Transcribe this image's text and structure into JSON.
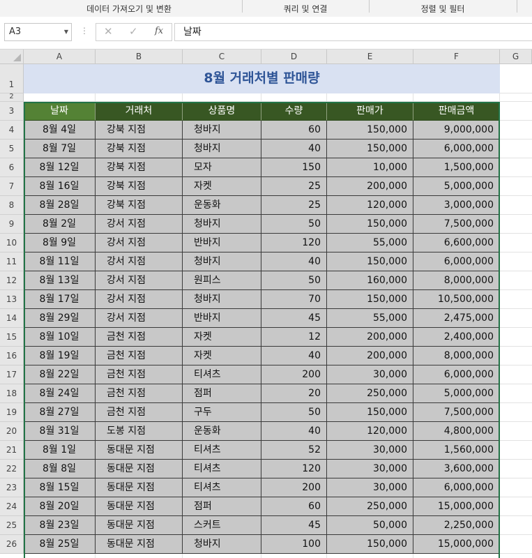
{
  "ribbon": {
    "groups": [
      "데이터 가져오기 및 변환",
      "쿼리 및 연결",
      "정렬 및 필터"
    ]
  },
  "formula_bar": {
    "name_box": "A3",
    "cancel_icon": "✕",
    "enter_icon": "✓",
    "fx_label": "fx",
    "formula": "날짜"
  },
  "columns": [
    "A",
    "B",
    "C",
    "D",
    "E",
    "F",
    "G"
  ],
  "rows": [
    "1",
    "2",
    "3",
    "4",
    "5",
    "6",
    "7",
    "8",
    "9",
    "10",
    "11",
    "12",
    "13",
    "14",
    "15",
    "16",
    "17",
    "18",
    "19",
    "20",
    "21",
    "22",
    "23",
    "24",
    "25",
    "26"
  ],
  "sheet": {
    "title": "8월 거래처별 판매량",
    "headers": [
      "날짜",
      "거래처",
      "상품명",
      "수량",
      "판매가",
      "판매금액"
    ],
    "data": [
      [
        "8월 4일",
        "강북 지점",
        "청바지",
        "60",
        "150,000",
        "9,000,000"
      ],
      [
        "8월 7일",
        "강북 지점",
        "청바지",
        "40",
        "150,000",
        "6,000,000"
      ],
      [
        "8월 12일",
        "강북 지점",
        "모자",
        "150",
        "10,000",
        "1,500,000"
      ],
      [
        "8월 16일",
        "강북 지점",
        "자켓",
        "25",
        "200,000",
        "5,000,000"
      ],
      [
        "8월 28일",
        "강북 지점",
        "운동화",
        "25",
        "120,000",
        "3,000,000"
      ],
      [
        "8월 2일",
        "강서 지점",
        "청바지",
        "50",
        "150,000",
        "7,500,000"
      ],
      [
        "8월 9일",
        "강서 지점",
        "반바지",
        "120",
        "55,000",
        "6,600,000"
      ],
      [
        "8월 11일",
        "강서 지점",
        "청바지",
        "40",
        "150,000",
        "6,000,000"
      ],
      [
        "8월 13일",
        "강서 지점",
        "원피스",
        "50",
        "160,000",
        "8,000,000"
      ],
      [
        "8월 17일",
        "강서 지점",
        "청바지",
        "70",
        "150,000",
        "10,500,000"
      ],
      [
        "8월 29일",
        "강서 지점",
        "반바지",
        "45",
        "55,000",
        "2,475,000"
      ],
      [
        "8월 10일",
        "금천 지점",
        "자켓",
        "12",
        "200,000",
        "2,400,000"
      ],
      [
        "8월 19일",
        "금천 지점",
        "자켓",
        "40",
        "200,000",
        "8,000,000"
      ],
      [
        "8월 22일",
        "금천 지점",
        "티셔츠",
        "200",
        "30,000",
        "6,000,000"
      ],
      [
        "8월 24일",
        "금천 지점",
        "점퍼",
        "20",
        "250,000",
        "5,000,000"
      ],
      [
        "8월 27일",
        "금천 지점",
        "구두",
        "50",
        "150,000",
        "7,500,000"
      ],
      [
        "8월 31일",
        "도봉 지점",
        "운동화",
        "40",
        "120,000",
        "4,800,000"
      ],
      [
        "8월 1일",
        "동대문 지점",
        "티셔츠",
        "52",
        "30,000",
        "1,560,000"
      ],
      [
        "8월 8일",
        "동대문 지점",
        "티셔츠",
        "120",
        "30,000",
        "3,600,000"
      ],
      [
        "8월 15일",
        "동대문 지점",
        "티셔츠",
        "200",
        "30,000",
        "6,000,000"
      ],
      [
        "8월 20일",
        "동대문 지점",
        "점퍼",
        "60",
        "250,000",
        "15,000,000"
      ],
      [
        "8월 23일",
        "동대문 지점",
        "스커트",
        "45",
        "50,000",
        "2,250,000"
      ],
      [
        "8월 25일",
        "동대문 지점",
        "청바지",
        "100",
        "150,000",
        "15,000,000"
      ]
    ]
  },
  "colors": {
    "header_bg": "#385723",
    "selected_header_bg": "#548235",
    "title_bg": "#d9e1f2",
    "title_text": "#2f5597",
    "data_bg": "#c8c8c8",
    "selection_border": "#217346"
  }
}
